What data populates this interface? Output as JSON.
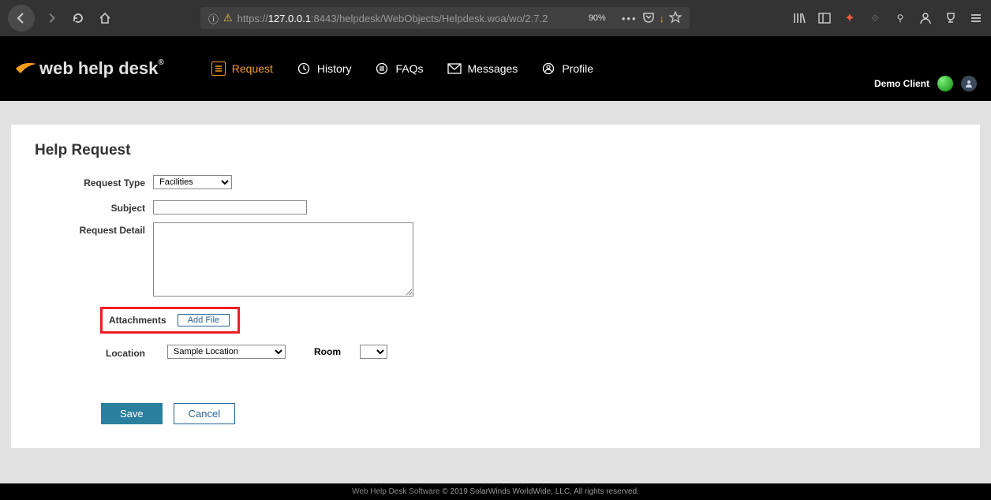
{
  "browser": {
    "url_prefix": "https://",
    "url_host": "127.0.0.1",
    "url_port": ":8443",
    "url_path": "/helpdesk/WebObjects/Helpdesk.woa/wo/2.7.2",
    "zoom": "90%"
  },
  "header": {
    "logo_text": "web help desk",
    "tabs": [
      {
        "label": "Request"
      },
      {
        "label": "History"
      },
      {
        "label": "FAQs"
      },
      {
        "label": "Messages"
      },
      {
        "label": "Profile"
      }
    ],
    "user_name": "Demo Client"
  },
  "form": {
    "title": "Help Request",
    "labels": {
      "request_type": "Request Type",
      "subject": "Subject",
      "request_detail": "Request Detail",
      "attachments": "Attachments",
      "add_file": "Add File",
      "location": "Location",
      "room": "Room"
    },
    "values": {
      "request_type": "Facilities",
      "subject": "",
      "request_detail": "",
      "location": "Sample Location",
      "room": ""
    },
    "buttons": {
      "save": "Save",
      "cancel": "Cancel"
    }
  },
  "footer": {
    "link_text": "Web Help Desk Software",
    "copyright": " © 2019 SolarWinds WorldWide, LLC. All rights reserved."
  }
}
